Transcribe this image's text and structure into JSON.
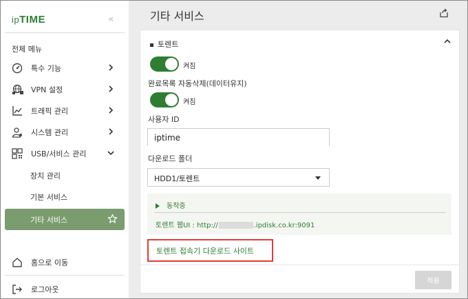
{
  "brand": {
    "logo_prefix": "ip",
    "logo_main": "TIME"
  },
  "sidebar": {
    "collapse_glyph": "«",
    "menu_header": "전체 메뉴",
    "items": [
      {
        "label": "특수 기능",
        "icon": "speedometer-icon"
      },
      {
        "label": "VPN 설정",
        "icon": "globe-network-icon"
      },
      {
        "label": "트래픽 관리",
        "icon": "chart-icon"
      },
      {
        "label": "시스템 관리",
        "icon": "user-gear-icon"
      },
      {
        "label": "USB/서비스 관리",
        "icon": "grid-icon",
        "expanded": true
      }
    ],
    "subitems": [
      {
        "label": "장치 관리"
      },
      {
        "label": "기본 서비스"
      },
      {
        "label": "기타 서비스",
        "active": true
      }
    ],
    "home_label": "홈으로 이동",
    "logout_label": "로그아웃"
  },
  "main": {
    "title": "기타 서비스",
    "section_title": "토렌트",
    "torrent_toggle_label": "켜짐",
    "autodelete_label": "완료목록 자동삭제(데이터유지)",
    "autodelete_toggle_label": "켜짐",
    "user_id_label": "사용자 ID",
    "user_id_value": "iptime",
    "download_folder_label": "다운로드 폴더",
    "download_folder_value": "HDD1/토렌트",
    "status": "동작중",
    "webui_prefix": "토렌트 웹UI : http://",
    "webui_suffix": ".ipdisk.co.kr:9091",
    "download_site_link": "토렌트 접속기 다운로드 사이트",
    "apply_label": "적용"
  },
  "colors": {
    "accent": "#2e7d32",
    "active_bg": "#7a9c6e",
    "highlight_border": "#e53935"
  }
}
